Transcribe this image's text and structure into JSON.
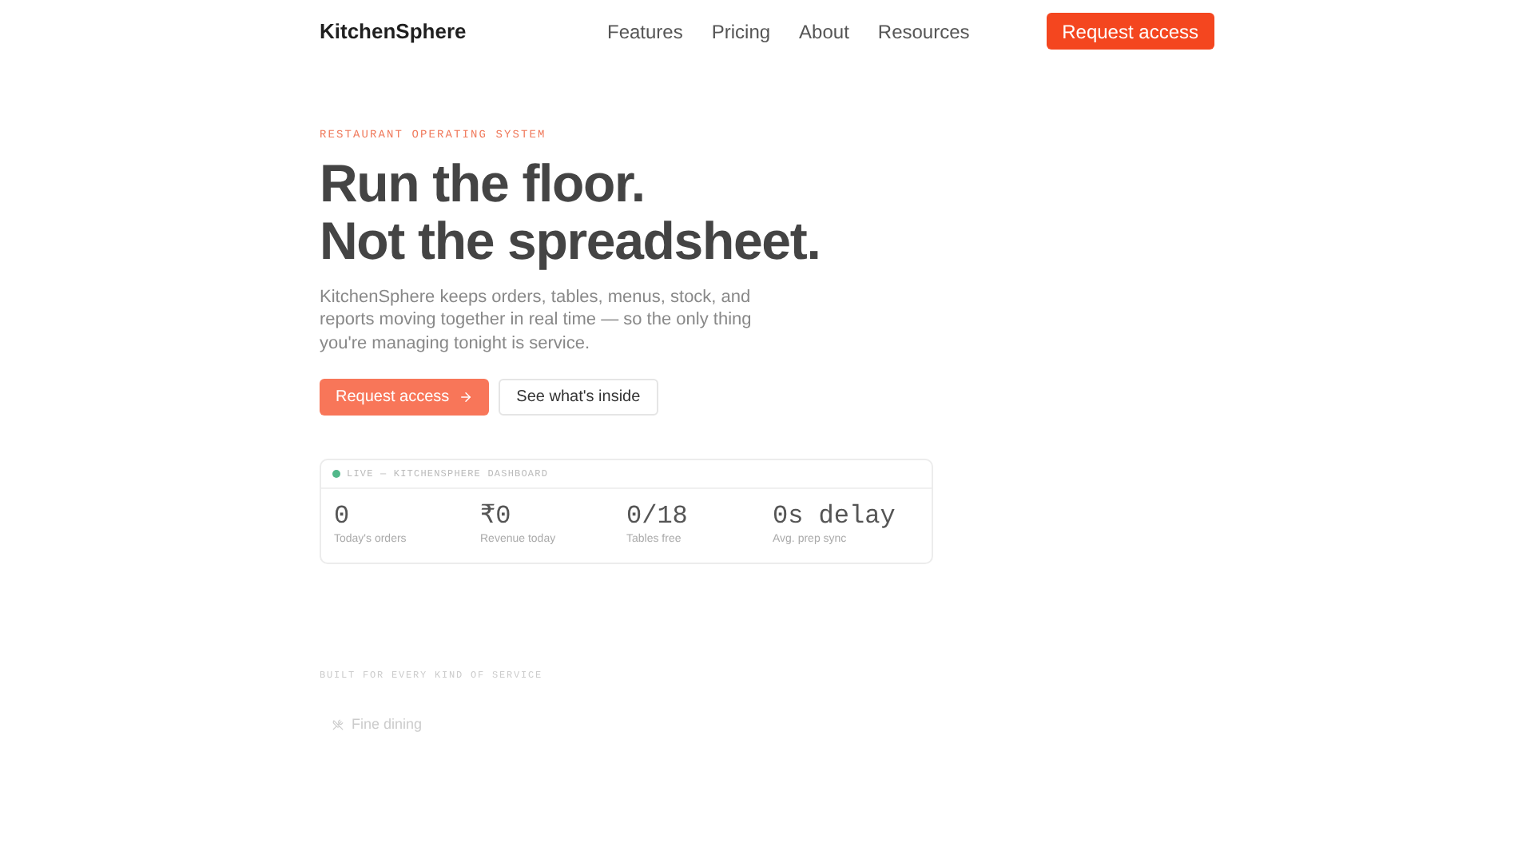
{
  "nav": {
    "logo": "KitchenSphere",
    "links": [
      "Features",
      "Pricing",
      "About",
      "Resources"
    ],
    "cta": "Request access"
  },
  "hero": {
    "eyebrow": "RESTAURANT OPERATING SYSTEM",
    "headline": [
      "Run the floor.",
      "Not the spreadsheet."
    ],
    "lead": "KitchenSphere keeps orders, tables, menus, stock, and reports moving together in real time — so the only thing you're managing tonight is service.",
    "primary": "Request access",
    "secondary": "See what's inside"
  },
  "dashboard": {
    "live": true,
    "label": "LIVE — KITCHENSPHERE DASHBOARD",
    "stats": [
      {
        "value": "0",
        "label": "Today's orders"
      },
      {
        "value": "₹0",
        "label": "Revenue today"
      },
      {
        "value": "0/18",
        "label": "Tables free"
      },
      {
        "value": "0s delay",
        "label": "Avg. prep sync"
      }
    ]
  },
  "segments": {
    "heading": "BUILT FOR EVERY KIND OF SERVICE",
    "items": [
      "Fine dining"
    ]
  }
}
